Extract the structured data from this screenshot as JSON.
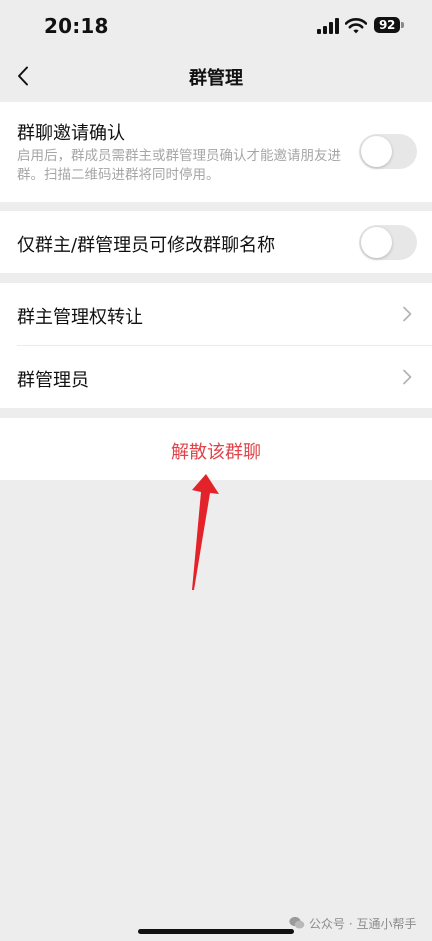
{
  "status_bar": {
    "time": "20:18",
    "battery": "92"
  },
  "nav": {
    "title": "群管理",
    "back_icon": "chevron-left-icon"
  },
  "settings": {
    "invite_confirm": {
      "title": "群聊邀请确认",
      "description": "启用后，群成员需群主或群管理员确认才能邀请朋友进群。扫描二维码进群将同时停用。",
      "enabled": false
    },
    "owner_admin_rename": {
      "title": "仅群主/群管理员可修改群聊名称",
      "enabled": false
    },
    "transfer_ownership": {
      "title": "群主管理权转让"
    },
    "admins": {
      "title": "群管理员"
    }
  },
  "danger_action": {
    "label": "解散该群聊",
    "color": "#e0444a"
  },
  "annotation": {
    "arrow_color": "#e3222a"
  },
  "watermark": {
    "text": "公众号 · 互通小帮手"
  },
  "colors": {
    "background": "#ededed",
    "card": "#ffffff",
    "secondary_text": "#a6a6a6"
  }
}
